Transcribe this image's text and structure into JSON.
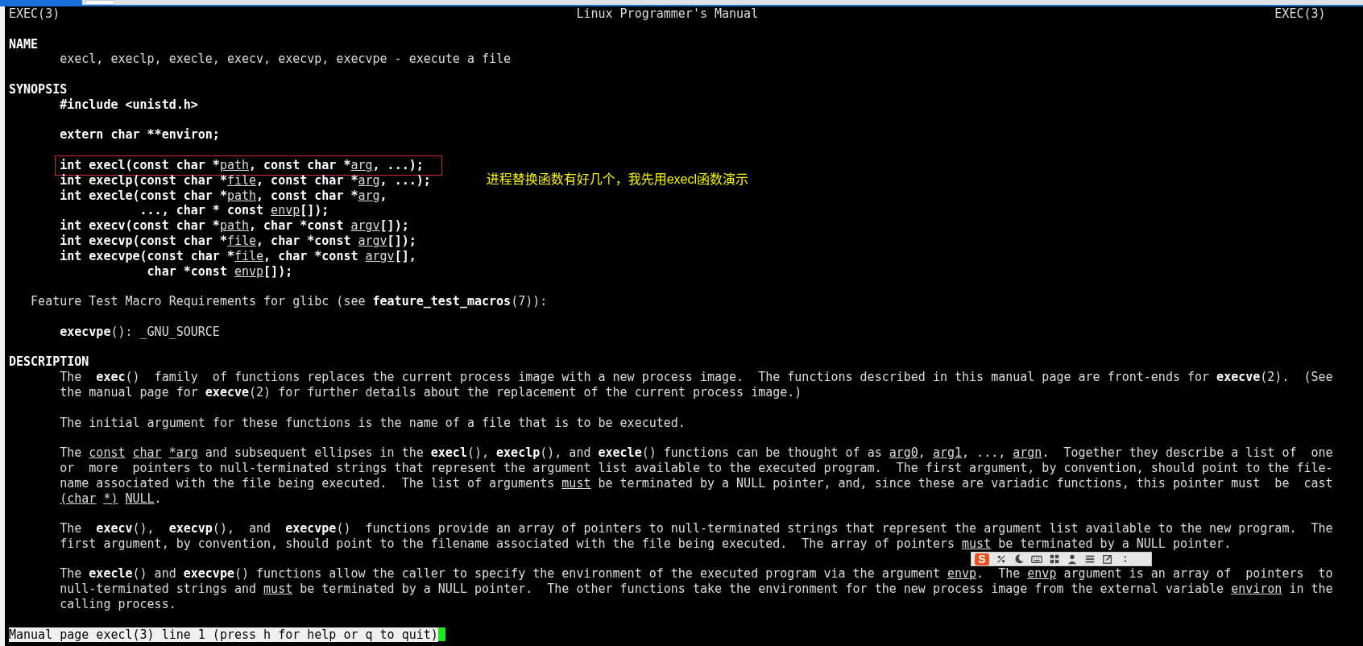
{
  "header": {
    "left": "EXEC(3)",
    "center": "Linux Programmer's Manual",
    "right": "EXEC(3)"
  },
  "lines": [
    {
      "kind": "blank"
    },
    {
      "kind": "heading",
      "text": "NAME"
    },
    {
      "kind": "body",
      "segments": [
        {
          "text": "execl, execlp, execle, execv, execvp, execvpe - execute a file"
        }
      ]
    },
    {
      "kind": "blank"
    },
    {
      "kind": "heading",
      "text": "SYNOPSIS"
    },
    {
      "kind": "code",
      "boxed": false,
      "segments": [
        {
          "text": "#include <unistd.h>",
          "kind": "keyword"
        }
      ]
    },
    {
      "kind": "blank"
    },
    {
      "kind": "code",
      "boxed": false,
      "segments": [
        {
          "text": "extern char **environ;",
          "kind": "keyword"
        }
      ]
    },
    {
      "kind": "blank"
    },
    {
      "kind": "code",
      "boxed": true,
      "segments": [
        {
          "text": "int execl(const char *",
          "kind": "keyword"
        },
        {
          "text": "path",
          "kind": "parameter"
        },
        {
          "text": ", const char *",
          "kind": "keyword"
        },
        {
          "text": "arg",
          "kind": "parameter"
        },
        {
          "text": ", ...);",
          "kind": "keyword"
        }
      ]
    },
    {
      "kind": "code",
      "boxed": false,
      "annotation": "进程替换函数有好几个，我先用execl函数演示",
      "segments": [
        {
          "text": "int execlp(const char *",
          "kind": "keyword"
        },
        {
          "text": "file",
          "kind": "parameter"
        },
        {
          "text": ", const char *",
          "kind": "keyword"
        },
        {
          "text": "arg",
          "kind": "parameter"
        },
        {
          "text": ", ...);",
          "kind": "keyword"
        }
      ]
    },
    {
      "kind": "code",
      "boxed": false,
      "segments": [
        {
          "text": "int execle(const char *",
          "kind": "keyword"
        },
        {
          "text": "path",
          "kind": "parameter"
        },
        {
          "text": ", const char *",
          "kind": "keyword"
        },
        {
          "text": "arg",
          "kind": "parameter"
        },
        {
          "text": ",",
          "kind": "keyword"
        }
      ]
    },
    {
      "kind": "code",
      "boxed": false,
      "segments": [
        {
          "text": "           ..., char * const ",
          "kind": "keyword"
        },
        {
          "text": "envp",
          "kind": "parameter"
        },
        {
          "text": "[]);",
          "kind": "keyword"
        }
      ]
    },
    {
      "kind": "code",
      "boxed": false,
      "segments": [
        {
          "text": "int execv(const char *",
          "kind": "keyword"
        },
        {
          "text": "path",
          "kind": "parameter"
        },
        {
          "text": ", char *const ",
          "kind": "keyword"
        },
        {
          "text": "argv",
          "kind": "parameter"
        },
        {
          "text": "[]);",
          "kind": "keyword"
        }
      ]
    },
    {
      "kind": "code",
      "boxed": false,
      "segments": [
        {
          "text": "int execvp(const char *",
          "kind": "keyword"
        },
        {
          "text": "file",
          "kind": "parameter"
        },
        {
          "text": ", char *const ",
          "kind": "keyword"
        },
        {
          "text": "argv",
          "kind": "parameter"
        },
        {
          "text": "[]);",
          "kind": "keyword"
        }
      ]
    },
    {
      "kind": "code",
      "boxed": false,
      "segments": [
        {
          "text": "int execvpe(const char *",
          "kind": "keyword"
        },
        {
          "text": "file",
          "kind": "parameter"
        },
        {
          "text": ", char *const ",
          "kind": "keyword"
        },
        {
          "text": "argv",
          "kind": "parameter"
        },
        {
          "text": "[],",
          "kind": "keyword"
        }
      ]
    },
    {
      "kind": "code",
      "boxed": false,
      "segments": [
        {
          "text": "            char *const ",
          "kind": "keyword"
        },
        {
          "text": "envp",
          "kind": "parameter"
        },
        {
          "text": "[]);",
          "kind": "keyword"
        }
      ]
    },
    {
      "kind": "blank"
    },
    {
      "kind": "note",
      "segments": [
        {
          "text": "Feature Test Macro Requirements for glibc (see "
        },
        {
          "text": "feature_test_macros",
          "kind": "keyword"
        },
        {
          "text": "(7)):"
        }
      ]
    },
    {
      "kind": "blank"
    },
    {
      "kind": "body",
      "segments": [
        {
          "text": "execvpe",
          "kind": "keyword"
        },
        {
          "text": "(): _GNU_SOURCE"
        }
      ]
    },
    {
      "kind": "blank"
    },
    {
      "kind": "heading",
      "text": "DESCRIPTION"
    },
    {
      "kind": "body",
      "segments": [
        {
          "text": "The  "
        },
        {
          "text": "exec",
          "kind": "keyword"
        },
        {
          "text": "()  family  of functions replaces the current process image with a new process image.  The functions described in this manual page are front-ends for "
        },
        {
          "text": "execve",
          "kind": "keyword"
        },
        {
          "text": "(2).  (See"
        }
      ]
    },
    {
      "kind": "body",
      "segments": [
        {
          "text": "the manual page for "
        },
        {
          "text": "execve",
          "kind": "keyword"
        },
        {
          "text": "(2) for further details about the replacement of the current process image.)"
        }
      ]
    },
    {
      "kind": "blank"
    },
    {
      "kind": "body",
      "segments": [
        {
          "text": "The initial argument for these functions is the name of a file that is to be executed."
        }
      ]
    },
    {
      "kind": "blank"
    },
    {
      "kind": "body",
      "segments": [
        {
          "text": "The "
        },
        {
          "text": "const char *arg",
          "kind": "parameter"
        },
        {
          "text": " and subsequent ellipses in the "
        },
        {
          "text": "execl",
          "kind": "keyword"
        },
        {
          "text": "(), "
        },
        {
          "text": "execlp",
          "kind": "keyword"
        },
        {
          "text": "(), and "
        },
        {
          "text": "execle",
          "kind": "keyword"
        },
        {
          "text": "() functions can be thought of as "
        },
        {
          "text": "arg0",
          "kind": "parameter"
        },
        {
          "text": ", "
        },
        {
          "text": "arg1",
          "kind": "parameter"
        },
        {
          "text": ", ..., "
        },
        {
          "text": "argn",
          "kind": "parameter"
        },
        {
          "text": ".  Together they describe a list of  one"
        }
      ]
    },
    {
      "kind": "body",
      "segments": [
        {
          "text": "or  more  pointers to null-terminated strings that represent the argument list available to the executed program.  The first argument, by convention, should point to the file-"
        }
      ]
    },
    {
      "kind": "body",
      "segments": [
        {
          "text": "name associated with the file being executed.  The list of arguments "
        },
        {
          "text": "must",
          "kind": "parameter"
        },
        {
          "text": " be terminated by a NULL pointer, and, since these are variadic functions, this pointer must  be  cast"
        }
      ]
    },
    {
      "kind": "body",
      "segments": [
        {
          "text": "(char *) NULL",
          "kind": "parameter"
        },
        {
          "text": "."
        }
      ]
    },
    {
      "kind": "blank"
    },
    {
      "kind": "body",
      "segments": [
        {
          "text": "The  "
        },
        {
          "text": "execv",
          "kind": "keyword"
        },
        {
          "text": "(),  "
        },
        {
          "text": "execvp",
          "kind": "keyword"
        },
        {
          "text": "(),  and  "
        },
        {
          "text": "execvpe",
          "kind": "keyword"
        },
        {
          "text": "()  functions provide an array of pointers to null-terminated strings that represent the argument list available to the new program.  The"
        }
      ]
    },
    {
      "kind": "body",
      "segments": [
        {
          "text": "first argument, by convention, should point to the filename associated with the file being executed.  The array of pointers "
        },
        {
          "text": "must",
          "kind": "parameter"
        },
        {
          "text": " be terminated by a NULL pointer."
        }
      ]
    },
    {
      "kind": "blank"
    },
    {
      "kind": "body",
      "segments": [
        {
          "text": "The "
        },
        {
          "text": "execle",
          "kind": "keyword"
        },
        {
          "text": "() and "
        },
        {
          "text": "execvpe",
          "kind": "keyword"
        },
        {
          "text": "() functions allow the caller to specify the environment of the executed program via the argument "
        },
        {
          "text": "envp",
          "kind": "parameter"
        },
        {
          "text": ".  The "
        },
        {
          "text": "envp",
          "kind": "parameter"
        },
        {
          "text": " argument is an array of  pointers  to"
        }
      ]
    },
    {
      "kind": "body",
      "segments": [
        {
          "text": "null-terminated strings and "
        },
        {
          "text": "must",
          "kind": "parameter"
        },
        {
          "text": " be terminated by a NULL pointer.  The other functions take the environment for the new process image from the external variable "
        },
        {
          "text": "environ",
          "kind": "parameter"
        },
        {
          "text": " in the"
        }
      ]
    },
    {
      "kind": "body",
      "segments": [
        {
          "text": "calling process."
        }
      ]
    },
    {
      "kind": "blank"
    }
  ],
  "ime_toolbar": {
    "logo": "S"
  },
  "status_line": {
    "text": "Manual page execl(3) line 1 (press h for help or q to quit)"
  }
}
